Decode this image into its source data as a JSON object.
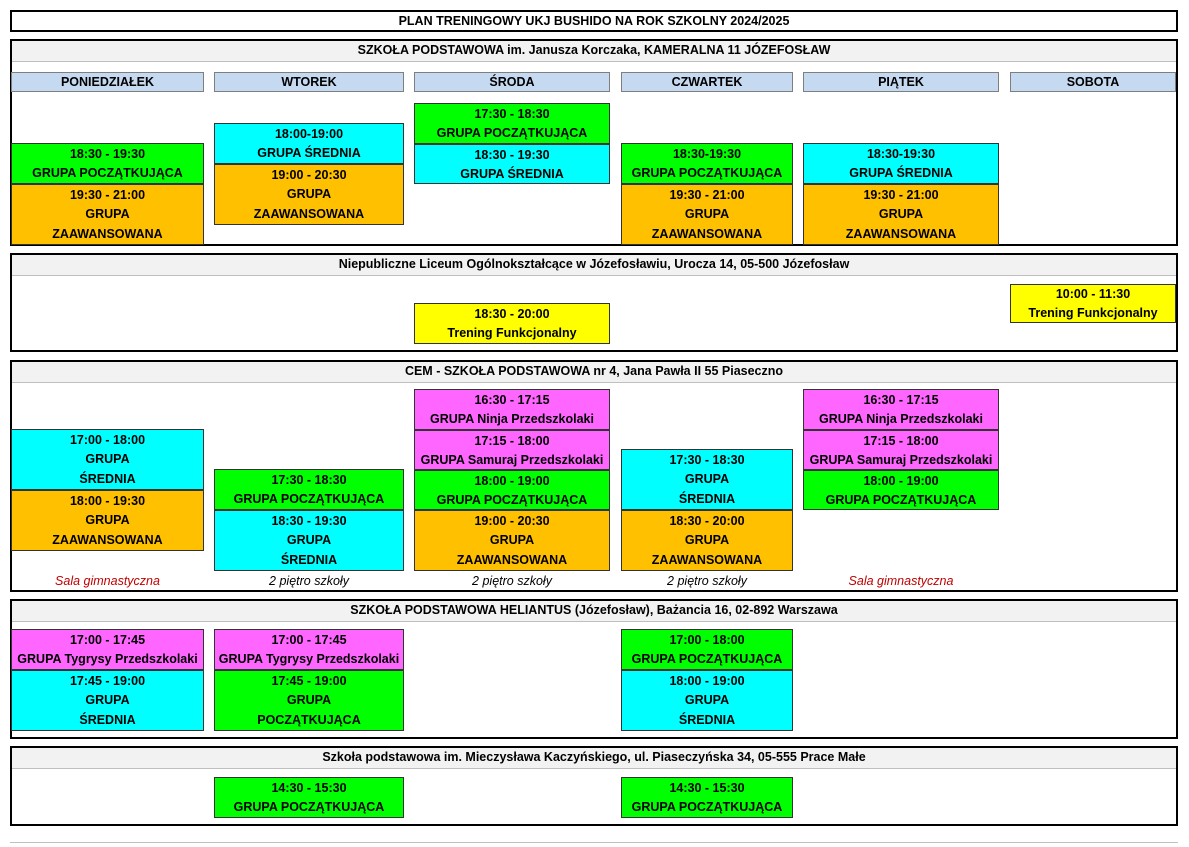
{
  "title": "PLAN TRENINGOWY UKJ BUSHIDO NA ROK SZKOLNY 2024/2025",
  "days": [
    "PONIEDZIAŁEK",
    "WTOREK",
    "ŚRODA",
    "CZWARTEK",
    "PIĄTEK",
    "SOBOTA"
  ],
  "sections": [
    {
      "name": "SZKOŁA PODSTAWOWA im. Janusza Korczaka, KAMERALNA 11 JÓZEFOSŁAW",
      "cells": [
        {
          "lines": [
            "18:30 - 19:30",
            "GRUPA POCZĄTKUJĄCA"
          ],
          "color": "#00ff00"
        },
        {
          "lines": [
            "19:30 - 21:00",
            "GRUPA",
            "ZAAWANSOWANA"
          ],
          "color": "#ffc000"
        },
        {
          "lines": [
            "18:00-19:00",
            "GRUPA ŚREDNIA"
          ],
          "color": "#00ffff"
        },
        {
          "lines": [
            "19:00 - 20:30",
            "GRUPA",
            "ZAAWANSOWANA"
          ],
          "color": "#ffc000"
        },
        {
          "lines": [
            "17:30 - 18:30",
            "GRUPA POCZĄTKUJĄCA"
          ],
          "color": "#00ff00"
        },
        {
          "lines": [
            "18:30 - 19:30",
            "GRUPA ŚREDNIA"
          ],
          "color": "#00ffff"
        },
        {
          "lines": [
            "18:30-19:30",
            "GRUPA POCZĄTKUJĄCA"
          ],
          "color": "#00ff00"
        },
        {
          "lines": [
            "19:30 - 21:00",
            "GRUPA",
            "ZAAWANSOWANA"
          ],
          "color": "#ffc000"
        },
        {
          "lines": [
            "18:30-19:30",
            "GRUPA ŚREDNIA"
          ],
          "color": "#00ffff"
        },
        {
          "lines": [
            "19:30 - 21:00",
            "GRUPA",
            "ZAAWANSOWANA"
          ],
          "color": "#ffc000"
        }
      ]
    },
    {
      "name": "Niepubliczne Liceum Ogólnokształcące w Józefosławiu, Urocza 14, 05-500 Józefosław",
      "cells": [
        {
          "lines": [
            "18:30 - 20:00",
            "Trening Funkcjonalny"
          ],
          "color": "#ffff00"
        },
        {
          "lines": [
            "10:00 - 11:30",
            "Trening Funkcjonalny"
          ],
          "color": "#ffff00"
        }
      ]
    },
    {
      "name": "CEM - SZKOŁA PODSTAWOWA nr 4, Jana Pawła II 55 Piaseczno",
      "cells": [
        {
          "lines": [
            "17:00 - 18:00",
            "GRUPA",
            "ŚREDNIA"
          ],
          "color": "#00ffff"
        },
        {
          "lines": [
            "18:00 - 19:30",
            "GRUPA",
            "ZAAWANSOWANA"
          ],
          "color": "#ffc000"
        },
        {
          "lines": [
            "17:30 - 18:30",
            "GRUPA POCZĄTKUJĄCA"
          ],
          "color": "#00ff00"
        },
        {
          "lines": [
            "18:30 - 19:30",
            "GRUPA",
            "ŚREDNIA"
          ],
          "color": "#00ffff"
        },
        {
          "lines": [
            "16:30 - 17:15",
            "GRUPA Ninja Przedszkolaki"
          ],
          "color": "#ff66ff"
        },
        {
          "lines": [
            "17:15 - 18:00",
            "GRUPA Samuraj Przedszkolaki"
          ],
          "color": "#ff66ff"
        },
        {
          "lines": [
            "18:00 - 19:00",
            "GRUPA POCZĄTKUJĄCA"
          ],
          "color": "#00ff00"
        },
        {
          "lines": [
            "19:00 - 20:30",
            "GRUPA",
            "ZAAWANSOWANA"
          ],
          "color": "#ffc000"
        },
        {
          "lines": [
            "17:30 - 18:30",
            "GRUPA",
            "ŚREDNIA"
          ],
          "color": "#00ffff"
        },
        {
          "lines": [
            "18:30 - 20:00",
            "GRUPA",
            "ZAAWANSOWANA"
          ],
          "color": "#ffc000"
        },
        {
          "lines": [
            "16:30 - 17:15",
            "GRUPA Ninja Przedszkolaki"
          ],
          "color": "#ff66ff"
        },
        {
          "lines": [
            "17:15 - 18:00",
            "GRUPA Samuraj Przedszkolaki"
          ],
          "color": "#ff66ff"
        },
        {
          "lines": [
            "18:00 - 19:00",
            "GRUPA POCZĄTKUJĄCA"
          ],
          "color": "#00ff00"
        }
      ],
      "locations": [
        {
          "text": "Sala gimnastyczna",
          "color": "#c00000"
        },
        {
          "text": "2 piętro szkoły",
          "color": "#000000"
        },
        {
          "text": "2 piętro szkoły",
          "color": "#000000"
        },
        {
          "text": "2 piętro szkoły",
          "color": "#000000"
        },
        {
          "text": "Sala gimnastyczna",
          "color": "#c00000"
        }
      ]
    },
    {
      "name": "SZKOŁA PODSTAWOWA HELIANTUS (Józefosław), Bażancia 16, 02-892 Warszawa",
      "cells": [
        {
          "lines": [
            "17:00 - 17:45",
            "GRUPA Tygrysy Przedszkolaki"
          ],
          "color": "#ff66ff"
        },
        {
          "lines": [
            "17:45 - 19:00",
            "GRUPA",
            "ŚREDNIA"
          ],
          "color": "#00ffff"
        },
        {
          "lines": [
            "17:00 - 17:45",
            "GRUPA Tygrysy Przedszkolaki"
          ],
          "color": "#ff66ff"
        },
        {
          "lines": [
            "17:45 - 19:00",
            "GRUPA",
            "POCZĄTKUJĄCA"
          ],
          "color": "#00ff00"
        },
        {
          "lines": [
            "17:00 - 18:00",
            "GRUPA POCZĄTKUJĄCA"
          ],
          "color": "#00ff00"
        },
        {
          "lines": [
            "18:00 - 19:00",
            "GRUPA",
            "ŚREDNIA"
          ],
          "color": "#00ffff"
        }
      ]
    },
    {
      "name": "Szkoła podstawowa im. Mieczysława Kaczyńskiego, ul. Piaseczyńska 34, 05-555 Prace Małe",
      "cells": [
        {
          "lines": [
            "14:30 - 15:30",
            "GRUPA POCZĄTKUJĄCA"
          ],
          "color": "#00ff00"
        },
        {
          "lines": [
            "14:30 - 15:30",
            "GRUPA POCZĄTKUJĄCA"
          ],
          "color": "#00ff00"
        }
      ]
    }
  ]
}
